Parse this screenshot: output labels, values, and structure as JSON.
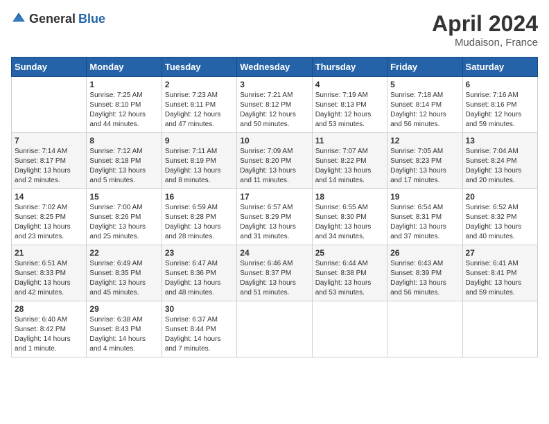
{
  "header": {
    "logo_general": "General",
    "logo_blue": "Blue",
    "title": "April 2024",
    "subtitle": "Mudaison, France"
  },
  "days_of_week": [
    "Sunday",
    "Monday",
    "Tuesday",
    "Wednesday",
    "Thursday",
    "Friday",
    "Saturday"
  ],
  "weeks": [
    [
      {
        "day": "",
        "sunrise": "",
        "sunset": "",
        "daylight": ""
      },
      {
        "day": "1",
        "sunrise": "Sunrise: 7:25 AM",
        "sunset": "Sunset: 8:10 PM",
        "daylight": "Daylight: 12 hours and 44 minutes."
      },
      {
        "day": "2",
        "sunrise": "Sunrise: 7:23 AM",
        "sunset": "Sunset: 8:11 PM",
        "daylight": "Daylight: 12 hours and 47 minutes."
      },
      {
        "day": "3",
        "sunrise": "Sunrise: 7:21 AM",
        "sunset": "Sunset: 8:12 PM",
        "daylight": "Daylight: 12 hours and 50 minutes."
      },
      {
        "day": "4",
        "sunrise": "Sunrise: 7:19 AM",
        "sunset": "Sunset: 8:13 PM",
        "daylight": "Daylight: 12 hours and 53 minutes."
      },
      {
        "day": "5",
        "sunrise": "Sunrise: 7:18 AM",
        "sunset": "Sunset: 8:14 PM",
        "daylight": "Daylight: 12 hours and 56 minutes."
      },
      {
        "day": "6",
        "sunrise": "Sunrise: 7:16 AM",
        "sunset": "Sunset: 8:16 PM",
        "daylight": "Daylight: 12 hours and 59 minutes."
      }
    ],
    [
      {
        "day": "7",
        "sunrise": "Sunrise: 7:14 AM",
        "sunset": "Sunset: 8:17 PM",
        "daylight": "Daylight: 13 hours and 2 minutes."
      },
      {
        "day": "8",
        "sunrise": "Sunrise: 7:12 AM",
        "sunset": "Sunset: 8:18 PM",
        "daylight": "Daylight: 13 hours and 5 minutes."
      },
      {
        "day": "9",
        "sunrise": "Sunrise: 7:11 AM",
        "sunset": "Sunset: 8:19 PM",
        "daylight": "Daylight: 13 hours and 8 minutes."
      },
      {
        "day": "10",
        "sunrise": "Sunrise: 7:09 AM",
        "sunset": "Sunset: 8:20 PM",
        "daylight": "Daylight: 13 hours and 11 minutes."
      },
      {
        "day": "11",
        "sunrise": "Sunrise: 7:07 AM",
        "sunset": "Sunset: 8:22 PM",
        "daylight": "Daylight: 13 hours and 14 minutes."
      },
      {
        "day": "12",
        "sunrise": "Sunrise: 7:05 AM",
        "sunset": "Sunset: 8:23 PM",
        "daylight": "Daylight: 13 hours and 17 minutes."
      },
      {
        "day": "13",
        "sunrise": "Sunrise: 7:04 AM",
        "sunset": "Sunset: 8:24 PM",
        "daylight": "Daylight: 13 hours and 20 minutes."
      }
    ],
    [
      {
        "day": "14",
        "sunrise": "Sunrise: 7:02 AM",
        "sunset": "Sunset: 8:25 PM",
        "daylight": "Daylight: 13 hours and 23 minutes."
      },
      {
        "day": "15",
        "sunrise": "Sunrise: 7:00 AM",
        "sunset": "Sunset: 8:26 PM",
        "daylight": "Daylight: 13 hours and 25 minutes."
      },
      {
        "day": "16",
        "sunrise": "Sunrise: 6:59 AM",
        "sunset": "Sunset: 8:28 PM",
        "daylight": "Daylight: 13 hours and 28 minutes."
      },
      {
        "day": "17",
        "sunrise": "Sunrise: 6:57 AM",
        "sunset": "Sunset: 8:29 PM",
        "daylight": "Daylight: 13 hours and 31 minutes."
      },
      {
        "day": "18",
        "sunrise": "Sunrise: 6:55 AM",
        "sunset": "Sunset: 8:30 PM",
        "daylight": "Daylight: 13 hours and 34 minutes."
      },
      {
        "day": "19",
        "sunrise": "Sunrise: 6:54 AM",
        "sunset": "Sunset: 8:31 PM",
        "daylight": "Daylight: 13 hours and 37 minutes."
      },
      {
        "day": "20",
        "sunrise": "Sunrise: 6:52 AM",
        "sunset": "Sunset: 8:32 PM",
        "daylight": "Daylight: 13 hours and 40 minutes."
      }
    ],
    [
      {
        "day": "21",
        "sunrise": "Sunrise: 6:51 AM",
        "sunset": "Sunset: 8:33 PM",
        "daylight": "Daylight: 13 hours and 42 minutes."
      },
      {
        "day": "22",
        "sunrise": "Sunrise: 6:49 AM",
        "sunset": "Sunset: 8:35 PM",
        "daylight": "Daylight: 13 hours and 45 minutes."
      },
      {
        "day": "23",
        "sunrise": "Sunrise: 6:47 AM",
        "sunset": "Sunset: 8:36 PM",
        "daylight": "Daylight: 13 hours and 48 minutes."
      },
      {
        "day": "24",
        "sunrise": "Sunrise: 6:46 AM",
        "sunset": "Sunset: 8:37 PM",
        "daylight": "Daylight: 13 hours and 51 minutes."
      },
      {
        "day": "25",
        "sunrise": "Sunrise: 6:44 AM",
        "sunset": "Sunset: 8:38 PM",
        "daylight": "Daylight: 13 hours and 53 minutes."
      },
      {
        "day": "26",
        "sunrise": "Sunrise: 6:43 AM",
        "sunset": "Sunset: 8:39 PM",
        "daylight": "Daylight: 13 hours and 56 minutes."
      },
      {
        "day": "27",
        "sunrise": "Sunrise: 6:41 AM",
        "sunset": "Sunset: 8:41 PM",
        "daylight": "Daylight: 13 hours and 59 minutes."
      }
    ],
    [
      {
        "day": "28",
        "sunrise": "Sunrise: 6:40 AM",
        "sunset": "Sunset: 8:42 PM",
        "daylight": "Daylight: 14 hours and 1 minute."
      },
      {
        "day": "29",
        "sunrise": "Sunrise: 6:38 AM",
        "sunset": "Sunset: 8:43 PM",
        "daylight": "Daylight: 14 hours and 4 minutes."
      },
      {
        "day": "30",
        "sunrise": "Sunrise: 6:37 AM",
        "sunset": "Sunset: 8:44 PM",
        "daylight": "Daylight: 14 hours and 7 minutes."
      },
      {
        "day": "",
        "sunrise": "",
        "sunset": "",
        "daylight": ""
      },
      {
        "day": "",
        "sunrise": "",
        "sunset": "",
        "daylight": ""
      },
      {
        "day": "",
        "sunrise": "",
        "sunset": "",
        "daylight": ""
      },
      {
        "day": "",
        "sunrise": "",
        "sunset": "",
        "daylight": ""
      }
    ]
  ]
}
